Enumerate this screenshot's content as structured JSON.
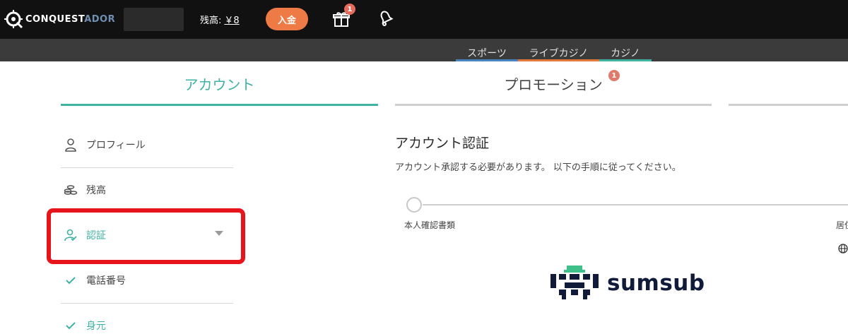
{
  "header": {
    "logo": {
      "part_a": "CONQUEST",
      "part_b": "ADOR"
    },
    "balance_label": "残高:",
    "balance_amount": "￥8",
    "deposit_label": "入金",
    "gift_badge": "1",
    "colors": {
      "bg": "#111111",
      "deposit": "#ee7b45",
      "badge": "#e46b5b"
    }
  },
  "subnav": {
    "items": [
      {
        "label": "スポーツ",
        "color": "#4a84c0"
      },
      {
        "label": "ライブカジノ",
        "color": "#e4773c"
      },
      {
        "label": "カジノ",
        "color": "#3fb2a3"
      }
    ]
  },
  "tabs": [
    {
      "label": "アカウント",
      "active": true
    },
    {
      "label": "プロモーション",
      "badge": "1",
      "active": false
    }
  ],
  "sidebar": {
    "items": [
      {
        "label": "プロフィール",
        "icon": "user-icon"
      },
      {
        "label": "残高",
        "icon": "coins-icon"
      },
      {
        "label": "認証",
        "icon": "user-check-icon",
        "active": true
      },
      {
        "label": "電話番号",
        "icon": "check-icon"
      },
      {
        "label": "身元",
        "icon": "check-icon"
      }
    ],
    "accent": "#3fb2a3"
  },
  "content": {
    "title": "アカウント認証",
    "subtitle": "アカウント承認する必要があります。 以下の手順に従ってください。",
    "steps": [
      {
        "label": "本人確認書類"
      },
      {
        "label": "居住"
      }
    ],
    "provider": "sumsub"
  }
}
